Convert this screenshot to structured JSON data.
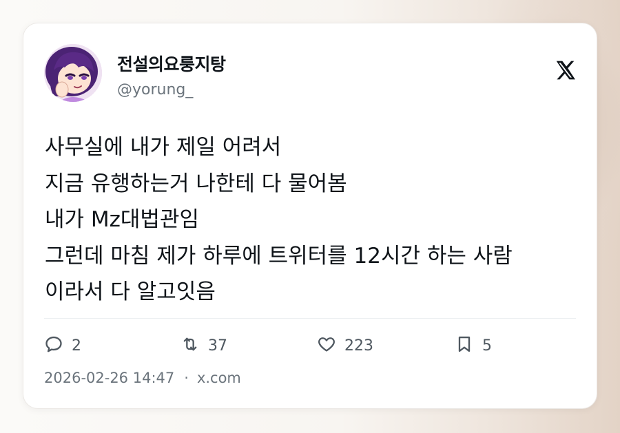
{
  "tweet": {
    "display_name": "전설의요룽지탕",
    "handle": "@yorung_",
    "lines": [
      "사무실에 내가 제일 어려서",
      "지금 유행하는거 나한테 다 물어봄",
      "내가 Mz대법관임",
      "그런데 마침 제가 하루에 트위터를 12시간 하는 사람",
      "이라서 다 알고잇음"
    ]
  },
  "stats": {
    "replies": "2",
    "retweets": "37",
    "likes": "223",
    "bookmarks": "5"
  },
  "meta": {
    "timestamp": "2026-02-26 14:47",
    "separator": "·",
    "source": "x.com"
  },
  "icons": {
    "platform_logo": "x-logo-icon",
    "reply": "reply-icon",
    "retweet": "retweet-icon",
    "like": "heart-icon",
    "bookmark": "bookmark-icon"
  },
  "colors": {
    "text": "#0f1419",
    "secondary": "#6b747c",
    "avatar_hair": "#5a2a86"
  }
}
